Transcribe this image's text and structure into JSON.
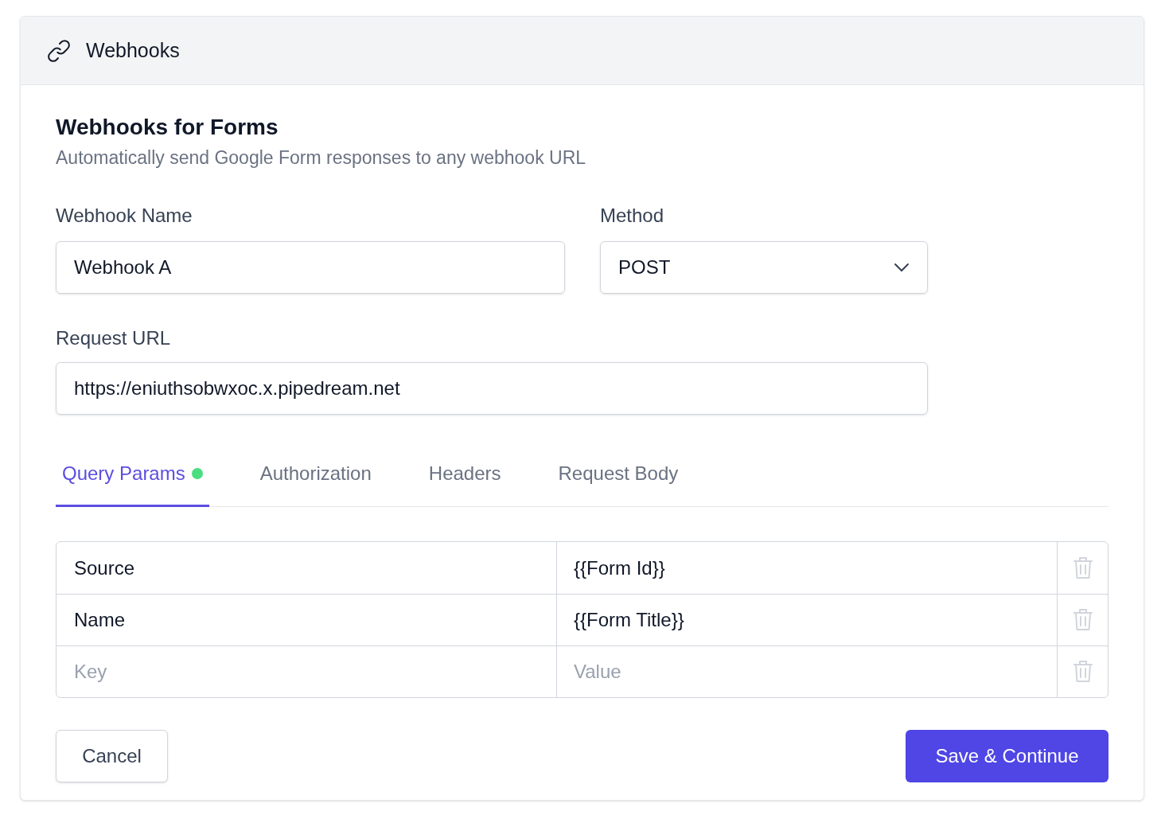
{
  "header": {
    "title": "Webhooks"
  },
  "heading": "Webhooks for Forms",
  "description": "Automatically send Google Form responses to any webhook URL",
  "webhook_name": {
    "label": "Webhook Name",
    "value": "Webhook A"
  },
  "method": {
    "label": "Method",
    "value": "POST"
  },
  "request_url": {
    "label": "Request URL",
    "value": "https://eniuthsobwxoc.x.pipedream.net"
  },
  "tabs": [
    {
      "label": "Query Params",
      "selected": true,
      "has_dot": true
    },
    {
      "label": "Authorization",
      "selected": false,
      "has_dot": false
    },
    {
      "label": "Headers",
      "selected": false,
      "has_dot": false
    },
    {
      "label": "Request Body",
      "selected": false,
      "has_dot": false
    }
  ],
  "params": [
    {
      "key": "Source",
      "value": "{{Form Id}}"
    },
    {
      "key": "Name",
      "value": "{{Form Title}}"
    },
    {
      "key_placeholder": "Key",
      "value_placeholder": "Value"
    }
  ],
  "buttons": {
    "cancel": "Cancel",
    "save": "Save & Continue"
  }
}
